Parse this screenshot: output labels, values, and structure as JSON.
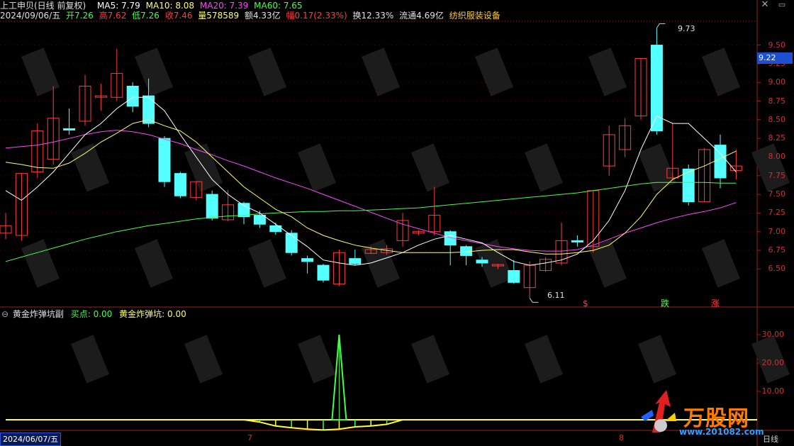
{
  "header": {
    "stock": "上工申贝(日线 前复权)",
    "ma5_label": "MA5: 7.79",
    "ma10_label": "MA10: 8.08",
    "ma20_label": "MA20: 7.39",
    "ma60_label": "MA60: 7.65",
    "date": "2024/09/06/五",
    "open": "开7.26",
    "high": "高7.62",
    "low": "低7.26",
    "close": "收7.46",
    "volume": "量578589",
    "amount": "额4.33亿",
    "change": "幅0.17(2.33%)",
    "turnover": "换12.33%",
    "float": "流通4.69亿",
    "sector": "纺织服装设备"
  },
  "window_controls": {
    "close": "✕",
    "toggle": "▭"
  },
  "colors": {
    "up": "#ff3c3c",
    "down": "#54ffff",
    "ma5": "#ffffff",
    "ma10": "#ffff66",
    "ma20": "#ff44ff",
    "ma60": "#44ff44",
    "axis": "#a01e1e",
    "current_price_tag": "#1e4fd1"
  },
  "price_axis": [
    "9.50",
    "9.25",
    "9.00",
    "8.75",
    "8.50",
    "8.25",
    "8.00",
    "7.75",
    "7.50",
    "7.25",
    "7.00",
    "6.75",
    "6.50"
  ],
  "current_price": "9.22",
  "annotations": {
    "high": "9.73",
    "low": "6.11"
  },
  "signals": {
    "s1": "$",
    "s2": "跌",
    "s3": "涨"
  },
  "indicator": {
    "name": "黄金炸弹坑副",
    "buy": "买点: 0.00",
    "bomb": "黄金炸弹坑: 0.00",
    "axis": [
      "30.00",
      "20.00",
      "10.00"
    ]
  },
  "time_axis": {
    "date_box": "2024/06/07/五",
    "month7": "7",
    "month8": "8",
    "period": "日线"
  },
  "watermark": {
    "logo": "万股网",
    "url": "www.201082.com"
  },
  "chart_data": {
    "type": "candlestick",
    "ylim": [
      6.0,
      9.8
    ],
    "candles": [
      {
        "o": 6.98,
        "c": 7.08,
        "h": 7.25,
        "l": 6.9,
        "dir": "up"
      },
      {
        "o": 6.95,
        "c": 7.78,
        "h": 7.78,
        "l": 6.88,
        "dir": "up"
      },
      {
        "o": 7.8,
        "c": 8.35,
        "h": 8.45,
        "l": 7.72,
        "dir": "up"
      },
      {
        "o": 7.97,
        "c": 8.52,
        "h": 8.95,
        "l": 7.9,
        "dir": "up"
      },
      {
        "o": 8.38,
        "c": 8.38,
        "h": 8.65,
        "l": 8.3,
        "dir": "down"
      },
      {
        "o": 8.48,
        "c": 8.95,
        "h": 9.1,
        "l": 8.42,
        "dir": "up"
      },
      {
        "o": 8.82,
        "c": 8.82,
        "h": 8.98,
        "l": 8.62,
        "dir": "up"
      },
      {
        "o": 8.8,
        "c": 9.12,
        "h": 9.45,
        "l": 8.75,
        "dir": "up"
      },
      {
        "o": 8.95,
        "c": 8.68,
        "h": 9.0,
        "l": 8.6,
        "dir": "down"
      },
      {
        "o": 8.82,
        "c": 8.45,
        "h": 9.05,
        "l": 8.4,
        "dir": "down"
      },
      {
        "o": 8.25,
        "c": 7.67,
        "h": 8.28,
        "l": 7.6,
        "dir": "down"
      },
      {
        "o": 7.78,
        "c": 7.48,
        "h": 7.8,
        "l": 7.45,
        "dir": "down"
      },
      {
        "o": 7.46,
        "c": 7.67,
        "h": 7.67,
        "l": 7.42,
        "dir": "up"
      },
      {
        "o": 7.5,
        "c": 7.18,
        "h": 7.55,
        "l": 7.15,
        "dir": "down"
      },
      {
        "o": 7.16,
        "c": 7.36,
        "h": 7.56,
        "l": 7.14,
        "dir": "up"
      },
      {
        "o": 7.38,
        "c": 7.2,
        "h": 7.4,
        "l": 7.1,
        "dir": "down"
      },
      {
        "o": 7.22,
        "c": 7.1,
        "h": 7.28,
        "l": 7.05,
        "dir": "down"
      },
      {
        "o": 7.08,
        "c": 7.0,
        "h": 7.12,
        "l": 6.96,
        "dir": "down"
      },
      {
        "o": 6.98,
        "c": 6.72,
        "h": 7.02,
        "l": 6.68,
        "dir": "down"
      },
      {
        "o": 6.64,
        "c": 6.6,
        "h": 6.68,
        "l": 6.44,
        "dir": "down"
      },
      {
        "o": 6.55,
        "c": 6.35,
        "h": 6.57,
        "l": 6.32,
        "dir": "down"
      },
      {
        "o": 6.3,
        "c": 6.72,
        "h": 6.76,
        "l": 6.27,
        "dir": "up"
      },
      {
        "o": 6.64,
        "c": 6.57,
        "h": 6.76,
        "l": 6.55,
        "dir": "down"
      },
      {
        "o": 6.71,
        "c": 6.76,
        "h": 6.8,
        "l": 6.7,
        "dir": "up"
      },
      {
        "o": 6.72,
        "c": 6.77,
        "h": 6.82,
        "l": 6.69,
        "dir": "up"
      },
      {
        "o": 6.88,
        "c": 7.15,
        "h": 7.25,
        "l": 6.8,
        "dir": "up"
      },
      {
        "o": 6.98,
        "c": 7.0,
        "h": 7.02,
        "l": 6.95,
        "dir": "up"
      },
      {
        "o": 7.22,
        "c": 7.0,
        "h": 7.6,
        "l": 6.95,
        "dir": "up"
      },
      {
        "o": 7.0,
        "c": 6.82,
        "h": 7.02,
        "l": 6.55,
        "dir": "down"
      },
      {
        "o": 6.8,
        "c": 6.68,
        "h": 6.82,
        "l": 6.55,
        "dir": "down"
      },
      {
        "o": 6.62,
        "c": 6.58,
        "h": 6.66,
        "l": 6.53,
        "dir": "down"
      },
      {
        "o": 6.56,
        "c": 6.55,
        "h": 6.57,
        "l": 6.5,
        "dir": "up"
      },
      {
        "o": 6.48,
        "c": 6.32,
        "h": 6.62,
        "l": 6.3,
        "dir": "down"
      },
      {
        "o": 6.25,
        "c": 6.55,
        "h": 6.6,
        "l": 6.11,
        "dir": "up"
      },
      {
        "o": 6.48,
        "c": 6.63,
        "h": 6.66,
        "l": 6.46,
        "dir": "up"
      },
      {
        "o": 6.58,
        "c": 6.88,
        "h": 7.12,
        "l": 6.55,
        "dir": "up"
      },
      {
        "o": 6.88,
        "c": 6.88,
        "h": 6.95,
        "l": 6.8,
        "dir": "down"
      },
      {
        "o": 6.8,
        "c": 7.55,
        "h": 7.55,
        "l": 6.72,
        "dir": "up"
      },
      {
        "o": 7.88,
        "c": 8.3,
        "h": 8.42,
        "l": 7.75,
        "dir": "up"
      },
      {
        "o": 8.1,
        "c": 8.42,
        "h": 8.52,
        "l": 8.0,
        "dir": "up"
      },
      {
        "o": 8.55,
        "c": 9.32,
        "h": 9.32,
        "l": 8.5,
        "dir": "up"
      },
      {
        "o": 8.35,
        "c": 9.5,
        "h": 9.73,
        "l": 8.3,
        "dir": "down"
      },
      {
        "o": 7.85,
        "c": 7.72,
        "h": 8.45,
        "l": 7.7,
        "dir": "up"
      },
      {
        "o": 7.84,
        "c": 7.4,
        "h": 7.9,
        "l": 7.35,
        "dir": "down"
      },
      {
        "o": 7.4,
        "c": 8.1,
        "h": 8.12,
        "l": 7.4,
        "dir": "up"
      },
      {
        "o": 8.16,
        "c": 7.72,
        "h": 8.3,
        "l": 7.58,
        "dir": "down"
      },
      {
        "o": 7.82,
        "c": 7.88,
        "h": 8.1,
        "l": 7.7,
        "dir": "up"
      }
    ],
    "ma5": [
      7.55,
      7.42,
      7.6,
      7.8,
      8.05,
      8.3,
      8.45,
      8.65,
      8.8,
      8.8,
      8.62,
      8.3,
      8.0,
      7.7,
      7.5,
      7.35,
      7.25,
      7.1,
      6.95,
      6.8,
      6.62,
      6.58,
      6.55,
      6.58,
      6.65,
      6.72,
      6.82,
      6.9,
      6.95,
      6.9,
      6.85,
      6.72,
      6.6,
      6.55,
      6.58,
      6.62,
      6.7,
      6.88,
      7.15,
      7.55,
      8.1,
      8.55,
      8.45,
      8.45,
      8.25,
      8.05,
      7.8
    ],
    "ma10": [
      7.93,
      7.9,
      7.86,
      7.85,
      7.92,
      8.05,
      8.2,
      8.32,
      8.45,
      8.5,
      8.42,
      8.35,
      8.2,
      8.0,
      7.8,
      7.6,
      7.45,
      7.3,
      7.2,
      7.05,
      6.95,
      6.88,
      6.82,
      6.78,
      6.75,
      6.72,
      6.72,
      6.72,
      6.72,
      6.73,
      6.75,
      6.76,
      6.76,
      6.73,
      6.7,
      6.7,
      6.72,
      6.75,
      6.82,
      6.98,
      7.2,
      7.5,
      7.7,
      7.8,
      7.88,
      7.98,
      8.08
    ],
    "ma20": [
      8.12,
      8.14,
      8.16,
      8.2,
      8.25,
      8.3,
      8.34,
      8.36,
      8.34,
      8.3,
      8.24,
      8.18,
      8.1,
      8.03,
      7.95,
      7.88,
      7.8,
      7.72,
      7.65,
      7.58,
      7.5,
      7.42,
      7.34,
      7.26,
      7.18,
      7.1,
      7.04,
      6.98,
      6.92,
      6.88,
      6.84,
      6.8,
      6.77,
      6.75,
      6.74,
      6.74,
      6.76,
      6.82,
      6.9,
      6.98,
      7.05,
      7.12,
      7.18,
      7.23,
      7.27,
      7.32,
      7.39
    ],
    "ma60": [
      6.6,
      6.66,
      6.72,
      6.78,
      6.84,
      6.9,
      6.95,
      7.0,
      7.04,
      7.08,
      7.11,
      7.14,
      7.17,
      7.19,
      7.21,
      7.22,
      7.24,
      7.25,
      7.26,
      7.27,
      7.27,
      7.28,
      7.28,
      7.29,
      7.3,
      7.31,
      7.32,
      7.34,
      7.36,
      7.38,
      7.4,
      7.42,
      7.44,
      7.46,
      7.48,
      7.5,
      7.52,
      7.55,
      7.58,
      7.61,
      7.64,
      7.66,
      7.66,
      7.66,
      7.66,
      7.65,
      7.65
    ],
    "indicator_series": {
      "ylim": [
        -5,
        35
      ],
      "baseline": 0,
      "bomb": [
        0,
        0,
        0,
        0,
        0,
        0,
        0,
        0,
        0,
        0,
        0,
        0,
        0,
        0,
        0,
        0,
        -0.8,
        -2.2,
        -2.8,
        -3.3,
        -3.6,
        -3.3,
        -2.5,
        -2.2,
        -1.6,
        0,
        0,
        0,
        0,
        0,
        0,
        0,
        0,
        0,
        0,
        0,
        0,
        0,
        0,
        0,
        0,
        0,
        0,
        0,
        0,
        0,
        0
      ],
      "spike": [
        {
          "index": 21,
          "value": 30
        }
      ]
    }
  }
}
